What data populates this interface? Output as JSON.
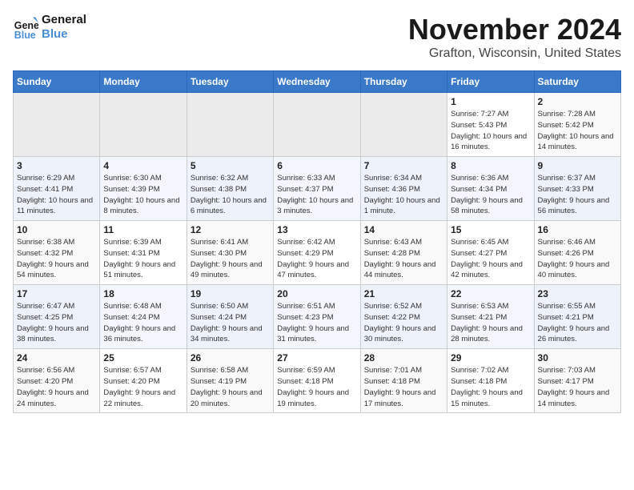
{
  "logo": {
    "line1": "General",
    "line2": "Blue"
  },
  "title": "November 2024",
  "location": "Grafton, Wisconsin, United States",
  "days_of_week": [
    "Sunday",
    "Monday",
    "Tuesday",
    "Wednesday",
    "Thursday",
    "Friday",
    "Saturday"
  ],
  "weeks": [
    [
      {
        "num": "",
        "empty": true
      },
      {
        "num": "",
        "empty": true
      },
      {
        "num": "",
        "empty": true
      },
      {
        "num": "",
        "empty": true
      },
      {
        "num": "",
        "empty": true
      },
      {
        "num": "1",
        "sunrise": "7:27 AM",
        "sunset": "5:43 PM",
        "daylight": "10 hours and 16 minutes."
      },
      {
        "num": "2",
        "sunrise": "7:28 AM",
        "sunset": "5:42 PM",
        "daylight": "10 hours and 14 minutes."
      }
    ],
    [
      {
        "num": "3",
        "sunrise": "6:29 AM",
        "sunset": "4:41 PM",
        "daylight": "10 hours and 11 minutes."
      },
      {
        "num": "4",
        "sunrise": "6:30 AM",
        "sunset": "4:39 PM",
        "daylight": "10 hours and 8 minutes."
      },
      {
        "num": "5",
        "sunrise": "6:32 AM",
        "sunset": "4:38 PM",
        "daylight": "10 hours and 6 minutes."
      },
      {
        "num": "6",
        "sunrise": "6:33 AM",
        "sunset": "4:37 PM",
        "daylight": "10 hours and 3 minutes."
      },
      {
        "num": "7",
        "sunrise": "6:34 AM",
        "sunset": "4:36 PM",
        "daylight": "10 hours and 1 minute."
      },
      {
        "num": "8",
        "sunrise": "6:36 AM",
        "sunset": "4:34 PM",
        "daylight": "9 hours and 58 minutes."
      },
      {
        "num": "9",
        "sunrise": "6:37 AM",
        "sunset": "4:33 PM",
        "daylight": "9 hours and 56 minutes."
      }
    ],
    [
      {
        "num": "10",
        "sunrise": "6:38 AM",
        "sunset": "4:32 PM",
        "daylight": "9 hours and 54 minutes."
      },
      {
        "num": "11",
        "sunrise": "6:39 AM",
        "sunset": "4:31 PM",
        "daylight": "9 hours and 51 minutes."
      },
      {
        "num": "12",
        "sunrise": "6:41 AM",
        "sunset": "4:30 PM",
        "daylight": "9 hours and 49 minutes."
      },
      {
        "num": "13",
        "sunrise": "6:42 AM",
        "sunset": "4:29 PM",
        "daylight": "9 hours and 47 minutes."
      },
      {
        "num": "14",
        "sunrise": "6:43 AM",
        "sunset": "4:28 PM",
        "daylight": "9 hours and 44 minutes."
      },
      {
        "num": "15",
        "sunrise": "6:45 AM",
        "sunset": "4:27 PM",
        "daylight": "9 hours and 42 minutes."
      },
      {
        "num": "16",
        "sunrise": "6:46 AM",
        "sunset": "4:26 PM",
        "daylight": "9 hours and 40 minutes."
      }
    ],
    [
      {
        "num": "17",
        "sunrise": "6:47 AM",
        "sunset": "4:25 PM",
        "daylight": "9 hours and 38 minutes."
      },
      {
        "num": "18",
        "sunrise": "6:48 AM",
        "sunset": "4:24 PM",
        "daylight": "9 hours and 36 minutes."
      },
      {
        "num": "19",
        "sunrise": "6:50 AM",
        "sunset": "4:24 PM",
        "daylight": "9 hours and 34 minutes."
      },
      {
        "num": "20",
        "sunrise": "6:51 AM",
        "sunset": "4:23 PM",
        "daylight": "9 hours and 31 minutes."
      },
      {
        "num": "21",
        "sunrise": "6:52 AM",
        "sunset": "4:22 PM",
        "daylight": "9 hours and 30 minutes."
      },
      {
        "num": "22",
        "sunrise": "6:53 AM",
        "sunset": "4:21 PM",
        "daylight": "9 hours and 28 minutes."
      },
      {
        "num": "23",
        "sunrise": "6:55 AM",
        "sunset": "4:21 PM",
        "daylight": "9 hours and 26 minutes."
      }
    ],
    [
      {
        "num": "24",
        "sunrise": "6:56 AM",
        "sunset": "4:20 PM",
        "daylight": "9 hours and 24 minutes."
      },
      {
        "num": "25",
        "sunrise": "6:57 AM",
        "sunset": "4:20 PM",
        "daylight": "9 hours and 22 minutes."
      },
      {
        "num": "26",
        "sunrise": "6:58 AM",
        "sunset": "4:19 PM",
        "daylight": "9 hours and 20 minutes."
      },
      {
        "num": "27",
        "sunrise": "6:59 AM",
        "sunset": "4:18 PM",
        "daylight": "9 hours and 19 minutes."
      },
      {
        "num": "28",
        "sunrise": "7:01 AM",
        "sunset": "4:18 PM",
        "daylight": "9 hours and 17 minutes."
      },
      {
        "num": "29",
        "sunrise": "7:02 AM",
        "sunset": "4:18 PM",
        "daylight": "9 hours and 15 minutes."
      },
      {
        "num": "30",
        "sunrise": "7:03 AM",
        "sunset": "4:17 PM",
        "daylight": "9 hours and 14 minutes."
      }
    ]
  ]
}
